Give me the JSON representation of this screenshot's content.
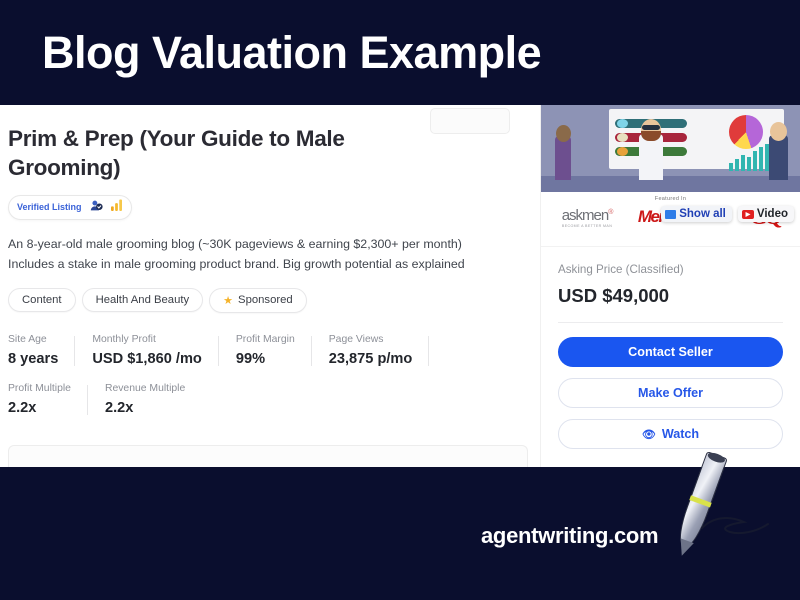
{
  "header": {
    "title": "Blog Valuation Example",
    "bg_color": "#0a0e2e",
    "text_color": "#ffffff"
  },
  "listing": {
    "title": "Prim & Prep (Your Guide to Male Grooming)",
    "verified_badge": "Verified Listing",
    "verified_icon_1": "people-badge-icon",
    "verified_icon_2": "bar-chart-icon",
    "description_line_1": "An 8-year-old male grooming blog (~30K pageviews & earning $2,300+ per month)",
    "description_line_2": "Includes a stake in male grooming product brand. Big growth potential as explained",
    "chips": [
      {
        "label": "Content",
        "starred": false
      },
      {
        "label": "Health And Beauty",
        "starred": false
      },
      {
        "label": "Sponsored",
        "starred": true
      }
    ],
    "stats_row_1": [
      {
        "label": "Site Age",
        "value": "8 years"
      },
      {
        "label": "Monthly Profit",
        "value": "USD $1,860 /mo"
      },
      {
        "label": "Profit Margin",
        "value": "99%"
      },
      {
        "label": "Page Views",
        "value": "23,875 p/mo"
      }
    ],
    "stats_row_2": [
      {
        "label": "Profit Multiple",
        "value": "2.2x"
      },
      {
        "label": "Revenue Multiple",
        "value": "2.2x"
      }
    ]
  },
  "sidebar": {
    "thumbnail_alt": "blog-preview-thumbnail",
    "featured_label": "Featured In",
    "logos": [
      {
        "name": "askmen",
        "text": "askmen",
        "sub": "BECOME A BETTER MAN"
      },
      {
        "name": "mens-health",
        "text": "Men's Health"
      },
      {
        "name": "gq",
        "text": "GQ"
      }
    ],
    "overlay_buttons": [
      {
        "label": "Show all",
        "icon": "image-icon"
      },
      {
        "label": "Video",
        "icon": "play-icon"
      }
    ],
    "price_label": "Asking Price (Classified)",
    "price_value": "USD $49,000",
    "actions": [
      {
        "label": "Contact Seller",
        "style": "primary",
        "icon": null
      },
      {
        "label": "Make Offer",
        "style": "outline",
        "icon": null
      },
      {
        "label": "Watch",
        "style": "outline",
        "icon": "eye-icon"
      }
    ],
    "accent_color": "#1a56f0"
  },
  "footer": {
    "brand": "agentwriting.com",
    "icon": "pen-signature-icon",
    "bg_color": "#0a0e2e"
  }
}
